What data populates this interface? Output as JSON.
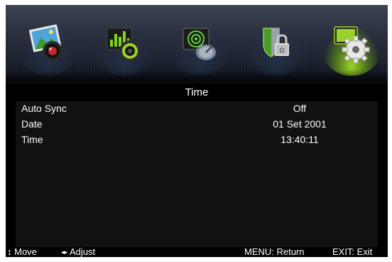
{
  "menu": {
    "tabs": [
      {
        "icon": "picture-icon"
      },
      {
        "icon": "sound-icon"
      },
      {
        "icon": "channel-icon"
      },
      {
        "icon": "lock-icon"
      },
      {
        "icon": "setup-gear-icon",
        "selected": true
      }
    ],
    "accent_color": "#9bd22a"
  },
  "page": {
    "title": "Time",
    "rows": [
      {
        "label": "Auto Sync",
        "value": "Off"
      },
      {
        "label": "Date",
        "value": "01 Set 2001"
      },
      {
        "label": "Time",
        "value": "13:40:11"
      }
    ]
  },
  "footer": {
    "move_icon": "↕",
    "move_label": "Move",
    "adjust_icon": "◂▸",
    "adjust_label": "Adjust",
    "return_label": "MENU: Return",
    "exit_label": "EXIT: Exit"
  }
}
